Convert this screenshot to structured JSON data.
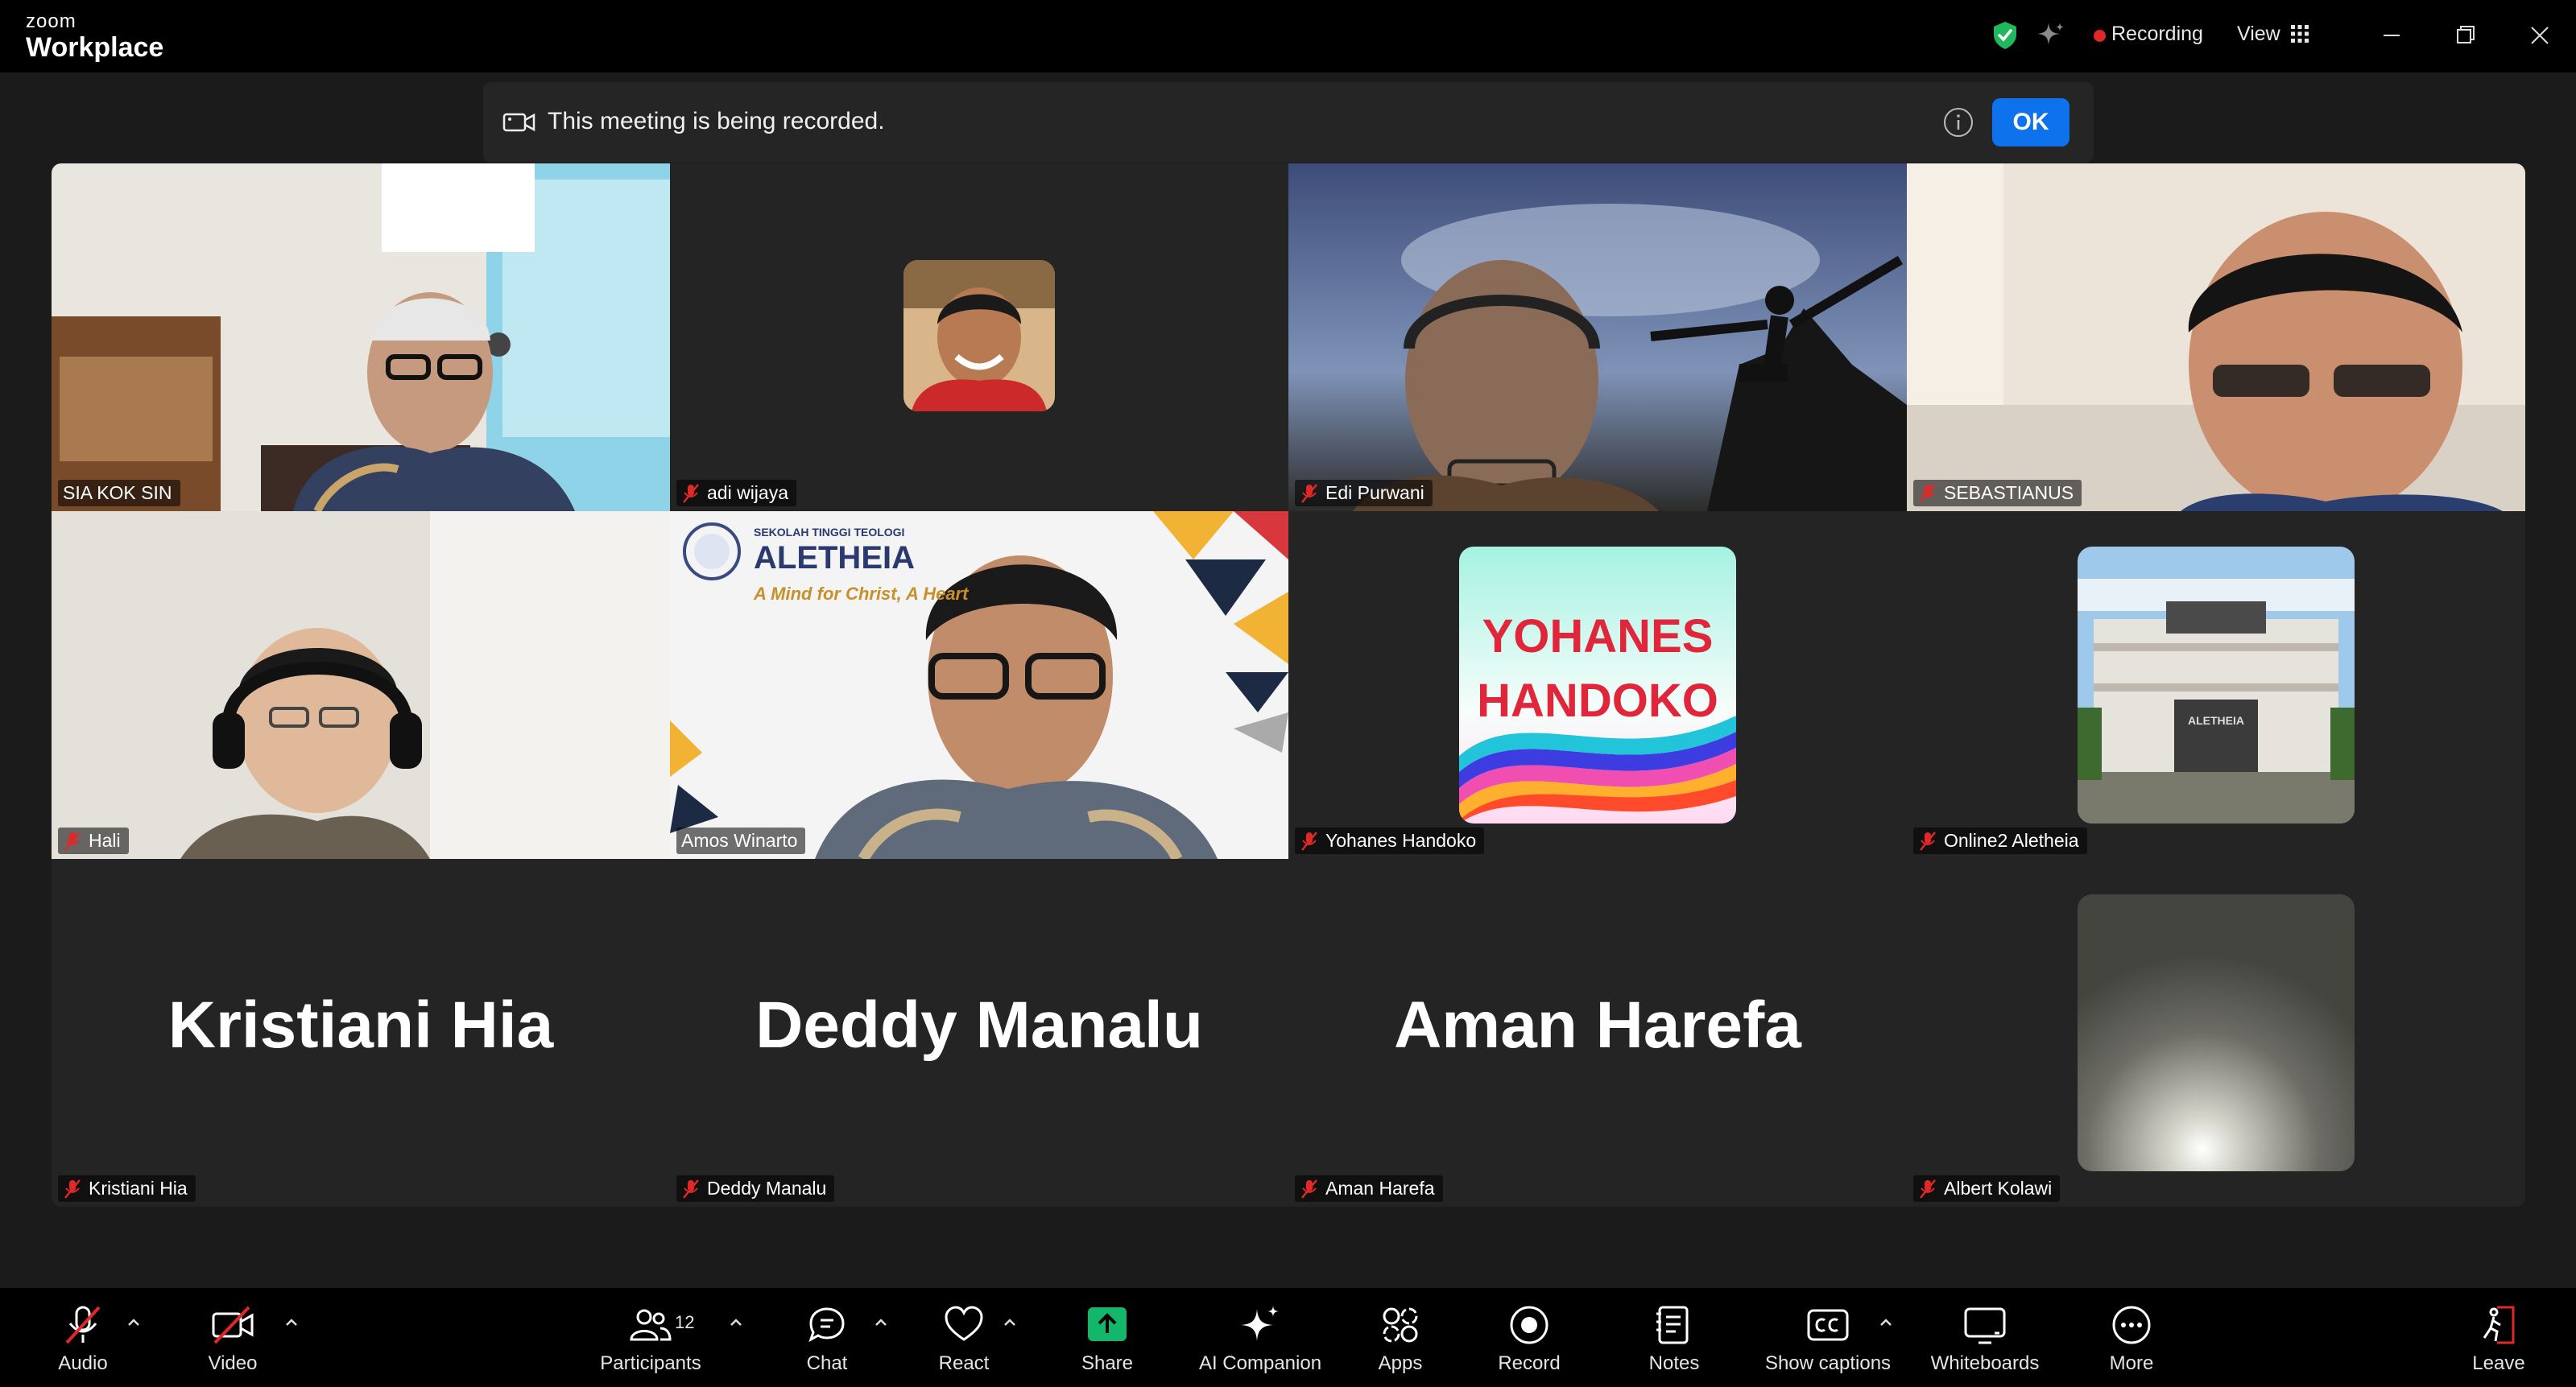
{
  "app": {
    "brand_small": "zoom",
    "brand_large": "Workplace"
  },
  "titlebar": {
    "recording_label": "Recording",
    "view_label": "View",
    "icons": [
      "shield-check-icon",
      "ai-sparkle-icon",
      "view-grid-icon",
      "minimize-icon",
      "restore-icon",
      "close-icon"
    ]
  },
  "banner": {
    "message": "This meeting is being recorded.",
    "ok_label": "OK",
    "icons": [
      "video-camera-icon",
      "info-icon"
    ]
  },
  "participants": [
    {
      "name": "SIA KOK SIN",
      "muted": false,
      "kind": "video"
    },
    {
      "name": "adi wijaya",
      "muted": true,
      "kind": "avatar"
    },
    {
      "name": "Edi Purwani",
      "muted": true,
      "kind": "video"
    },
    {
      "name": "SEBASTIANUS",
      "muted": true,
      "kind": "video"
    },
    {
      "name": "Hali",
      "muted": true,
      "kind": "video"
    },
    {
      "name": "Amos Winarto",
      "muted": false,
      "kind": "video",
      "active": true,
      "backdrop": {
        "school_line": "SEKOLAH TINGGI TEOLOGI",
        "school_name": "ALETHEIA",
        "motto": "A Mind for Christ, A Heart"
      }
    },
    {
      "name": "Yohanes Handoko",
      "muted": true,
      "kind": "avatar",
      "avatar_text_1": "YOHANES",
      "avatar_text_2": "HANDOKO"
    },
    {
      "name": "Online2 Aletheia",
      "muted": true,
      "kind": "avatar",
      "building_sign": "ALETHEIA"
    },
    {
      "name": "Kristiani Hia",
      "muted": true,
      "kind": "name",
      "display": "Kristiani Hia"
    },
    {
      "name": "Deddy Manalu",
      "muted": true,
      "kind": "name",
      "display": "Deddy Manalu"
    },
    {
      "name": "Aman Harefa",
      "muted": true,
      "kind": "name",
      "display": "Aman Harefa"
    },
    {
      "name": "Albert Kolawi",
      "muted": true,
      "kind": "avatar"
    }
  ],
  "toolbar": {
    "audio": "Audio",
    "video": "Video",
    "participants": "Participants",
    "participants_count": "12",
    "chat": "Chat",
    "react": "React",
    "share": "Share",
    "ai_companion": "AI Companion",
    "apps": "Apps",
    "record": "Record",
    "notes": "Notes",
    "captions": "Show captions",
    "whiteboards": "Whiteboards",
    "more": "More",
    "leave": "Leave"
  },
  "colors": {
    "accent": "#0e72ed",
    "active_border": "#23d98a",
    "recording": "#e02828",
    "share": "#12b76a",
    "mute": "#e02828"
  }
}
